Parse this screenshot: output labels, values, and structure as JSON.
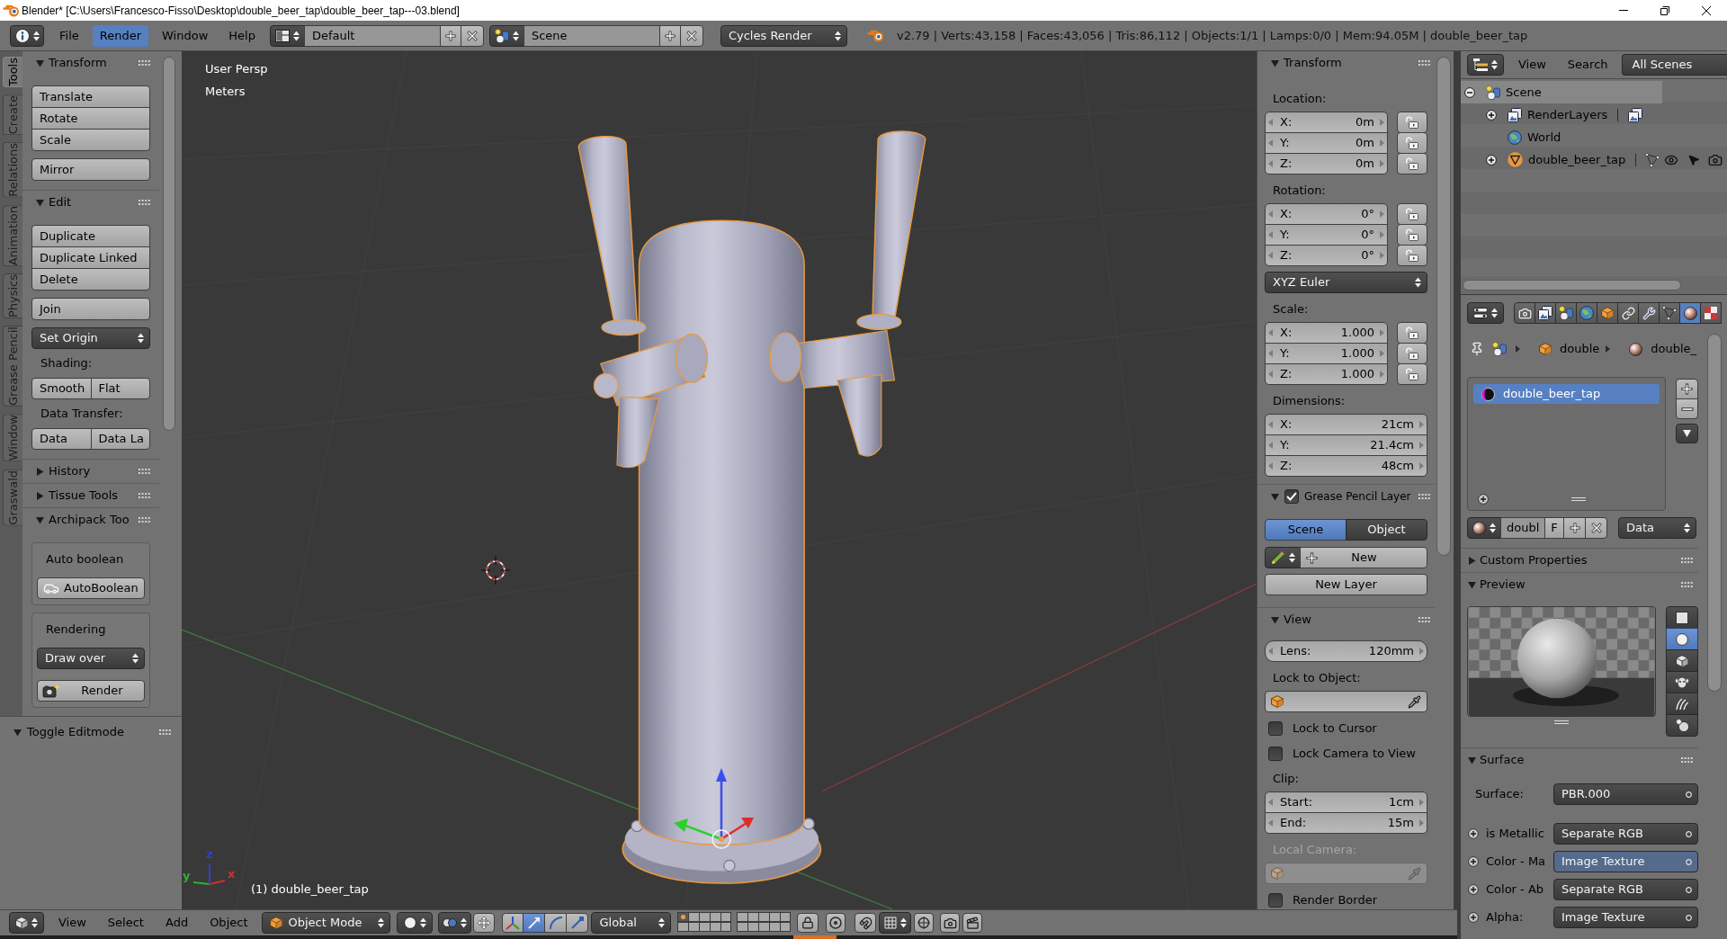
{
  "window": {
    "title": "Blender* [C:\\Users\\Francesco-Fisso\\Desktop\\double_beer_tap\\double_beer_tap---03.blend]"
  },
  "info_header": {
    "menus": [
      {
        "label": "File",
        "selected": false
      },
      {
        "label": "Render",
        "selected": true
      },
      {
        "label": "Window",
        "selected": false
      },
      {
        "label": "Help",
        "selected": false
      }
    ],
    "screen_layout": "Default",
    "scene": "Scene",
    "render_engine": "Cycles Render",
    "stats": "v2.79 | Verts:43,158 | Faces:43,056 | Tris:86,112 | Objects:1/1 | Lamps:0/0 | Mem:94.05M | double_beer_tap"
  },
  "tool_tabs": [
    {
      "label": "Tools",
      "selected": true
    },
    {
      "label": "Create",
      "selected": false
    },
    {
      "label": "Relations",
      "selected": false
    },
    {
      "label": "Animation",
      "selected": false
    },
    {
      "label": "Physics",
      "selected": false
    },
    {
      "label": "Grease Pencil",
      "selected": false
    },
    {
      "label": "Window",
      "selected": false
    },
    {
      "label": "Graswald",
      "selected": false
    }
  ],
  "tool_shelf": {
    "panels": [
      {
        "title": "Transform",
        "expanded": true,
        "items": [
          {
            "kind": "column",
            "buttons": [
              "Translate",
              "Rotate",
              "Scale"
            ]
          },
          {
            "kind": "column",
            "buttons": [
              "Mirror"
            ]
          }
        ]
      },
      {
        "title": "Edit",
        "expanded": true,
        "items": [
          {
            "kind": "column",
            "buttons": [
              "Duplicate",
              "Duplicate Linked",
              "Delete"
            ]
          },
          {
            "kind": "column",
            "buttons": [
              "Join"
            ]
          },
          {
            "kind": "menu",
            "value": "Set Origin"
          },
          {
            "kind": "label",
            "text": "Shading:"
          },
          {
            "kind": "row",
            "buttons": [
              "Smooth",
              "Flat"
            ]
          },
          {
            "kind": "label",
            "text": "Data Transfer:"
          },
          {
            "kind": "row",
            "buttons": [
              "Data",
              "Data La"
            ]
          }
        ]
      },
      {
        "title": "History",
        "expanded": false
      },
      {
        "title": "Tissue Tools",
        "expanded": false
      },
      {
        "title": "Archipack Too",
        "expanded": true,
        "items": [
          {
            "kind": "box",
            "items": [
              {
                "kind": "label",
                "text": "Auto boolean"
              },
              {
                "kind": "boolean",
                "label": "AutoBoolean"
              }
            ]
          },
          {
            "kind": "box",
            "items": [
              {
                "kind": "label",
                "text": "Rendering"
              },
              {
                "kind": "menu",
                "value": "Draw over"
              },
              {
                "kind": "render",
                "label": "Render"
              }
            ]
          }
        ]
      }
    ]
  },
  "redo_panel": {
    "title": "Toggle Editmode",
    "expanded": true
  },
  "viewport": {
    "view_name": "User Persp",
    "units": "Meters",
    "axes": [
      {
        "label": "x",
        "color": "#d03030"
      },
      {
        "label": "y",
        "color": "#30b030"
      },
      {
        "label": "z",
        "color": "#3040d0"
      }
    ],
    "object_label": "(1) double_beer_tap"
  },
  "properties_region": {
    "panels": [
      {
        "title": "Transform",
        "expanded": true,
        "items": [
          {
            "kind": "label",
            "text": "Location:"
          },
          {
            "kind": "vector",
            "fields": [
              {
                "label": "X:",
                "value": "0m",
                "locked": false
              },
              {
                "label": "Y:",
                "value": "0m",
                "locked": false
              },
              {
                "label": "Z:",
                "value": "0m",
                "locked": false
              }
            ]
          },
          {
            "kind": "label",
            "text": "Rotation:"
          },
          {
            "kind": "vector",
            "fields": [
              {
                "label": "X:",
                "value": "0°",
                "locked": false
              },
              {
                "label": "Y:",
                "value": "0°",
                "locked": false
              },
              {
                "label": "Z:",
                "value": "0°",
                "locked": false
              }
            ]
          },
          {
            "kind": "menu",
            "value": "XYZ Euler"
          },
          {
            "kind": "label",
            "text": "Scale:"
          },
          {
            "kind": "vector",
            "fields": [
              {
                "label": "X:",
                "value": "1.000",
                "locked": false
              },
              {
                "label": "Y:",
                "value": "1.000",
                "locked": false
              },
              {
                "label": "Z:",
                "value": "1.000",
                "locked": false
              }
            ]
          },
          {
            "kind": "label",
            "text": "Dimensions:"
          },
          {
            "kind": "vector",
            "fields": [
              {
                "label": "X:",
                "value": "21cm"
              },
              {
                "label": "Y:",
                "value": "21.4cm"
              },
              {
                "label": "Z:",
                "value": "48cm"
              }
            ]
          }
        ]
      },
      {
        "title": "Grease Pencil Layer",
        "expanded": true,
        "checked": true,
        "items": [
          {
            "kind": "segmented",
            "options": [
              {
                "label": "Scene",
                "selected": true
              },
              {
                "label": "Object",
                "selected": false
              }
            ]
          },
          {
            "kind": "new",
            "label": "New"
          },
          {
            "kind": "button",
            "label": "New Layer"
          }
        ]
      },
      {
        "title": "View",
        "expanded": true,
        "items": [
          {
            "kind": "number",
            "label": "Lens:",
            "value": "120mm"
          },
          {
            "kind": "label",
            "text": "Lock to Object:",
            "disabled": false
          },
          {
            "kind": "object_field",
            "disabled": false
          },
          {
            "kind": "checkbox",
            "label": "Lock to Cursor",
            "checked": false
          },
          {
            "kind": "checkbox",
            "label": "Lock Camera to View",
            "checked": false
          },
          {
            "kind": "label",
            "text": "Clip:",
            "disabled": false
          },
          {
            "kind": "vector",
            "fields": [
              {
                "label": "Start:",
                "value": "1cm"
              },
              {
                "label": "End:",
                "value": "15m"
              }
            ]
          },
          {
            "kind": "label",
            "text": "Local Camera:",
            "disabled": true
          },
          {
            "kind": "object_field",
            "disabled": true
          },
          {
            "kind": "checkbox",
            "label": "Render Border",
            "checked": false
          }
        ]
      }
    ]
  },
  "outliner": {
    "menus": [
      "View",
      "Search"
    ],
    "filter": "All Scenes",
    "tree": [
      {
        "label": "Scene",
        "kind": "scene",
        "expanded": true,
        "selected": true,
        "children": [
          {
            "label": "RenderLayers",
            "kind": "render_layers",
            "expanded": false,
            "selected": false
          },
          {
            "label": "World",
            "kind": "world",
            "selected": false
          },
          {
            "label": "double_beer_tap",
            "kind": "mesh_object",
            "expanded": false,
            "selected": false,
            "visible": true,
            "selectable": true,
            "renderable": true
          }
        ]
      }
    ]
  },
  "properties_editor": {
    "tabs": [
      {
        "kind": "render",
        "selected": false
      },
      {
        "kind": "layers",
        "selected": false
      },
      {
        "kind": "scene",
        "selected": false
      },
      {
        "kind": "world",
        "selected": false
      },
      {
        "kind": "object",
        "selected": false
      },
      {
        "kind": "constraints",
        "selected": false
      },
      {
        "kind": "modifiers",
        "selected": false
      },
      {
        "kind": "data",
        "selected": false
      },
      {
        "kind": "material",
        "selected": true
      },
      {
        "kind": "texture",
        "selected": false
      }
    ],
    "breadcrumb": [
      {
        "kind": "object",
        "label": "double"
      },
      {
        "kind": "material",
        "label": "double_"
      }
    ],
    "material_slots": [
      {
        "name": "double_beer_tap",
        "selected": true
      }
    ],
    "id_block": {
      "name": "doubl",
      "fake_user": "F",
      "link": "Data"
    },
    "panels": [
      {
        "title": "Custom Properties",
        "expanded": false
      },
      {
        "kind": "preview",
        "title": "Preview",
        "expanded": true,
        "shapes": [
          {
            "kind": "plane",
            "selected": false
          },
          {
            "kind": "sphere",
            "selected": true
          },
          {
            "kind": "cube",
            "selected": false
          },
          {
            "kind": "monkey",
            "selected": false
          },
          {
            "kind": "hair",
            "selected": false
          },
          {
            "kind": "sky",
            "selected": false
          }
        ]
      },
      {
        "kind": "surface",
        "title": "Surface",
        "expanded": true,
        "rows": [
          {
            "label": "Surface:",
            "value": "PBR.000",
            "socket": false,
            "highlighted": false
          },
          {
            "label": "is Metallic",
            "value": "Separate RGB",
            "socket": true,
            "highlighted": false
          },
          {
            "label": "Color - Ma",
            "value": "Image Texture",
            "socket": true,
            "highlighted": true
          },
          {
            "label": "Color - Ab",
            "value": "Separate RGB",
            "socket": true,
            "highlighted": false
          },
          {
            "label": "Alpha:",
            "value": "Image Texture",
            "socket": true,
            "highlighted": false
          }
        ]
      }
    ]
  },
  "view3d_header": {
    "menus": [
      "View",
      "Select",
      "Add",
      "Object"
    ],
    "mode": "Object Mode",
    "transform_tools": [
      {
        "kind": "translate",
        "selected": true
      },
      {
        "kind": "rotate",
        "selected": false
      },
      {
        "kind": "scale",
        "selected": false
      }
    ],
    "orientation": "Global",
    "layers": [
      {
        "selected": true,
        "used": true
      },
      {
        "selected": false,
        "used": false
      },
      {
        "selected": false,
        "used": false
      },
      {
        "selected": false,
        "used": false
      },
      {
        "selected": false,
        "used": false
      },
      {
        "selected": false,
        "used": false
      },
      {
        "selected": false,
        "used": false
      },
      {
        "selected": false,
        "used": false
      },
      {
        "selected": false,
        "used": false
      },
      {
        "selected": false,
        "used": false
      },
      {
        "selected": false,
        "used": false
      },
      {
        "selected": false,
        "used": false
      },
      {
        "selected": false,
        "used": false
      },
      {
        "selected": false,
        "used": false
      },
      {
        "selected": false,
        "used": false
      },
      {
        "selected": false,
        "used": false
      },
      {
        "selected": false,
        "used": false
      },
      {
        "selected": false,
        "used": false
      },
      {
        "selected": false,
        "used": false
      },
      {
        "selected": false,
        "used": false
      }
    ]
  }
}
